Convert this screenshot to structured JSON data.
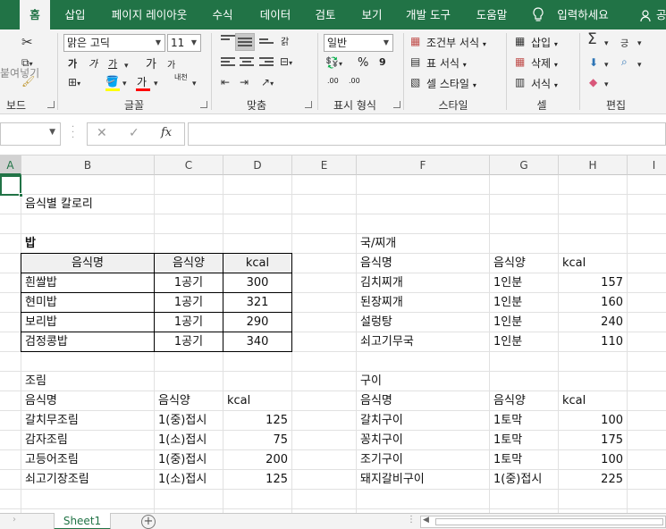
{
  "ribbon_tabs": [
    "홈",
    "삽입",
    "페이지 레이아웃",
    "수식",
    "데이터",
    "검토",
    "보기",
    "개발 도구",
    "도움말",
    "입력하세요",
    "공"
  ],
  "ribbon": {
    "clipboard": {
      "label": "보드",
      "paste_label": "붙여넣기"
    },
    "font": {
      "label": "글꼴",
      "font_name": "맑은 고딕",
      "font_size": "11",
      "bold": "가",
      "italic": "가",
      "underline": "가",
      "grow": "가",
      "shrink": "가",
      "color_glyph": "가",
      "phonetic": "내천",
      "font_color": "#ff0000",
      "fill_color": "#ffff00"
    },
    "alignment": {
      "label": "맞춤",
      "wrap": "갉"
    },
    "number": {
      "label": "표시 형식",
      "format": "일반",
      "percent": "%",
      "comma": "9",
      "inc_decimal": ".00",
      "dec_decimal": ".00"
    },
    "styles": {
      "label": "스타일",
      "conditional": "조건부 서식",
      "table": "표 서식",
      "cell_style": "셀 스타일"
    },
    "cells": {
      "label": "셀",
      "insert": "삽입",
      "delete": "삭제",
      "format": "서식"
    },
    "editing": {
      "label": "편집",
      "sort": "긍"
    }
  },
  "formula_bar": {
    "name_box": "",
    "fx": "fx",
    "content": ""
  },
  "columns": [
    "A",
    "B",
    "C",
    "D",
    "E",
    "F",
    "G",
    "H",
    "I"
  ],
  "sheet": {
    "title": "음식별 칼로리",
    "rice": {
      "title": "밥",
      "headers": [
        "음식명",
        "음식양",
        "kcal"
      ],
      "rows": [
        [
          "흰쌀밥",
          "1공기",
          "300"
        ],
        [
          "현미밥",
          "1공기",
          "321"
        ],
        [
          "보리밥",
          "1공기",
          "290"
        ],
        [
          "검정콩밥",
          "1공기",
          "340"
        ]
      ]
    },
    "soup": {
      "title": "국/찌개",
      "headers": [
        "음식명",
        "음식양",
        "kcal"
      ],
      "rows": [
        [
          "김치찌개",
          "1인분",
          "157"
        ],
        [
          "된장찌개",
          "1인분",
          "160"
        ],
        [
          "설렁탕",
          "1인분",
          "240"
        ],
        [
          "쇠고기무국",
          "1인분",
          "110"
        ]
      ]
    },
    "braised": {
      "title": "조림",
      "headers": [
        "음식명",
        "음식양",
        "kcal"
      ],
      "rows": [
        [
          "갈치무조림",
          "1(중)접시",
          "125"
        ],
        [
          "감자조림",
          "1(소)접시",
          "75"
        ],
        [
          "고등어조림",
          "1(중)접시",
          "200"
        ],
        [
          "쇠고기장조림",
          "1(소)접시",
          "125"
        ]
      ]
    },
    "grilled": {
      "title": "구이",
      "headers": [
        "음식명",
        "음식양",
        "kcal"
      ],
      "rows": [
        [
          "갈치구이",
          "1토막",
          "100"
        ],
        [
          "꽁치구이",
          "1토막",
          "175"
        ],
        [
          "조기구이",
          "1토막",
          "100"
        ],
        [
          "돼지갈비구이",
          "1(중)접시",
          "225"
        ]
      ]
    }
  },
  "sheet_tabs": {
    "active": "Sheet1",
    "add": "+"
  },
  "colors": {
    "excel_green": "#217346"
  }
}
